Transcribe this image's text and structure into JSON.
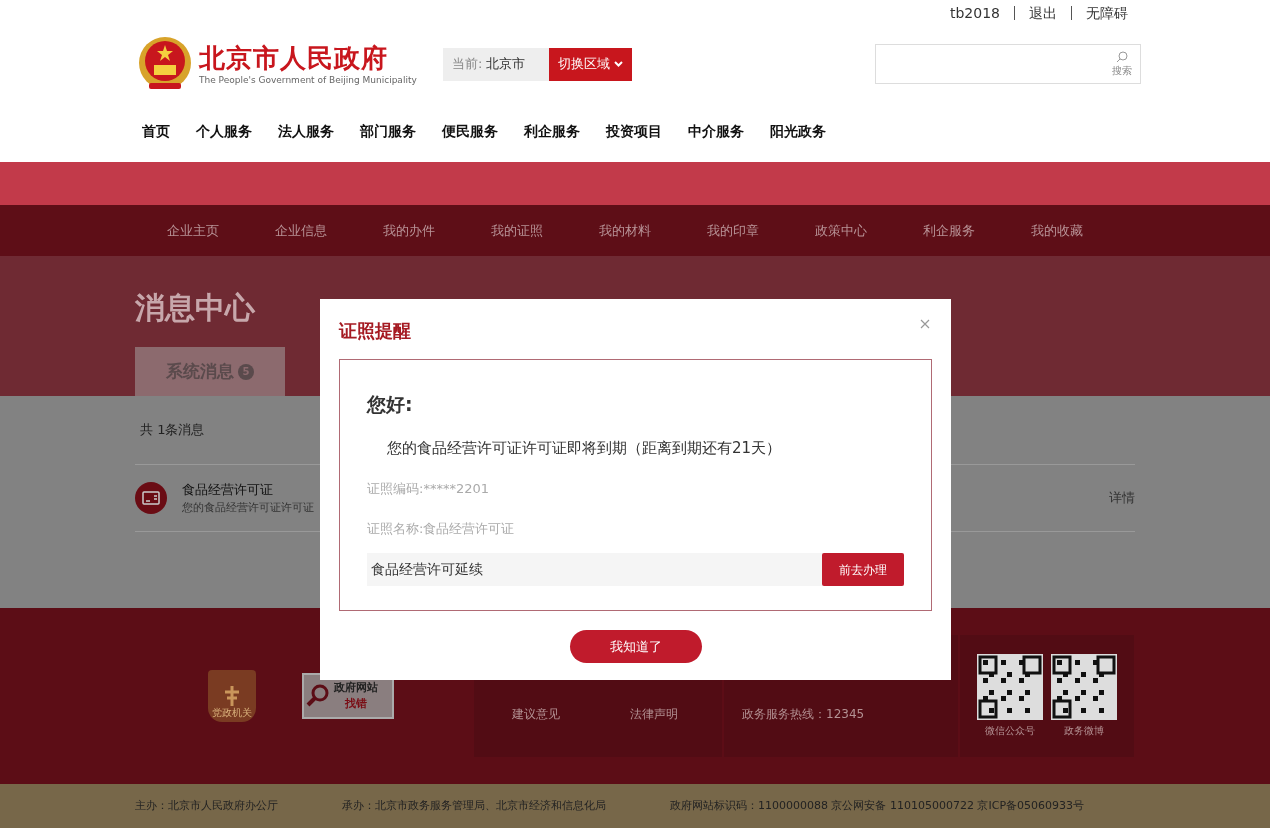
{
  "top_links": [
    "tb2018",
    "退出",
    "无障碍"
  ],
  "logo": {
    "title": "北京市人民政府",
    "subtitle": "The People's Government of Beijing Municipality"
  },
  "region": {
    "label": "当前:",
    "value": "北京市",
    "button": "切换区域"
  },
  "search": {
    "button": "搜索"
  },
  "main_nav": [
    "首页",
    "个人服务",
    "法人服务",
    "部门服务",
    "便民服务",
    "利企服务",
    "投资项目",
    "中介服务",
    "阳光政务"
  ],
  "sub_nav": [
    "企业主页",
    "企业信息",
    "我的办件",
    "我的证照",
    "我的材料",
    "我的印章",
    "政策中心",
    "利企服务",
    "我的收藏"
  ],
  "banner": {
    "title": "消息中心",
    "tabs": [
      {
        "label": "系统消息",
        "badge": "5",
        "selected": true
      }
    ]
  },
  "content": {
    "count": "共 1条消息",
    "messages": [
      {
        "title": "食品经营许可证",
        "description": "您的食品经营许可证许可证",
        "action": "详情"
      }
    ]
  },
  "modal": {
    "title": "证照提醒",
    "greeting": "您好:",
    "body": "您的食品经营许可证许可证即将到期（距离到期还有21天）",
    "fields": [
      "证照编码:*****2201",
      "证照名称:食品经营许可证"
    ],
    "service": {
      "name": "食品经营许可延续",
      "button": "前去办理"
    },
    "confirm": "我知道了"
  },
  "footer": {
    "badge": "党政机关",
    "error_report": {
      "line1": "政府网站",
      "line2": "找错"
    },
    "links": [
      "建议意见",
      "法律声明"
    ],
    "hotline": "政务服务热线：12345",
    "qr_codes": [
      {
        "label": "微信公众号"
      },
      {
        "label": "政务微博"
      }
    ],
    "bottom": [
      "主办：北京市人民政府办公厅",
      "承办：北京市政务服务管理局、北京市经济和信息化局",
      "政府网站标识码：1100000088 京公网安备 110105000722 京ICP备05060933号"
    ]
  }
}
